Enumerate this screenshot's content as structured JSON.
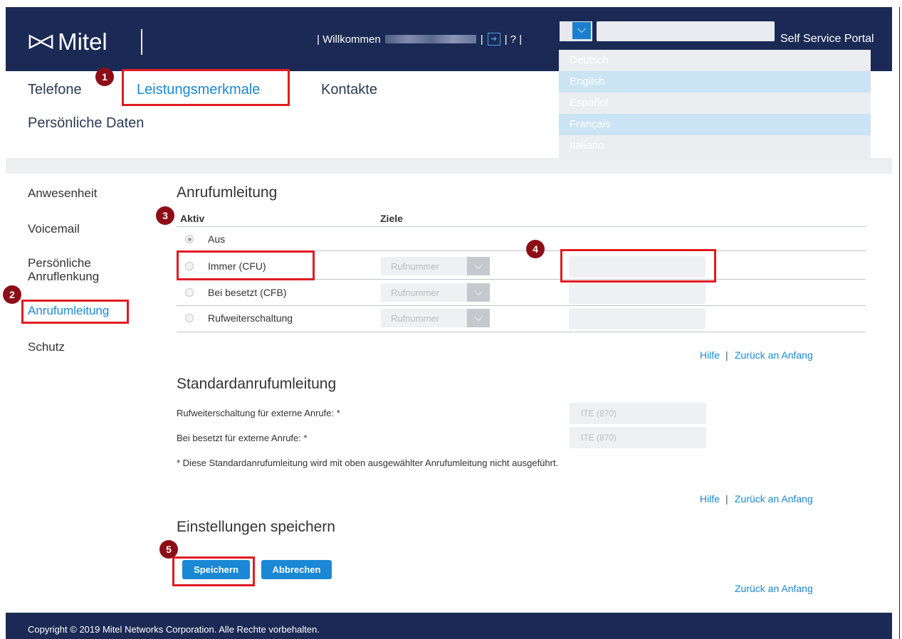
{
  "header": {
    "logo_text": "Mitel",
    "welcome": "| Willkommen",
    "sep1": "|",
    "help": "| ? |",
    "portal_title": "Self Service Portal"
  },
  "language_dropdown": {
    "options": [
      "Deutsch",
      "English",
      "Español",
      "Français",
      "Italiano"
    ]
  },
  "top_nav": {
    "telefone": "Telefone",
    "leistungsmerkmale": "Leistungsmerkmale",
    "kontakte": "Kontakte",
    "persoenliche_daten": "Persönliche Daten"
  },
  "side_nav": {
    "anwesenheit": "Anwesenheit",
    "voicemail": "Voicemail",
    "anruflenkung_1": "Persönliche",
    "anruflenkung_2": "Anruflenkung",
    "anrufumleitung": "Anrufumleitung",
    "schutz": "Schutz"
  },
  "badges": [
    "1",
    "2",
    "3",
    "4",
    "5"
  ],
  "call_forward": {
    "title": "Anrufumleitung",
    "col_active": "Aktiv",
    "col_targets": "Ziele",
    "rows": [
      {
        "label": "Aus",
        "selected": true
      },
      {
        "label": "Immer (CFU)",
        "select": "Rufnummer"
      },
      {
        "label": "Bei besetzt (CFB)",
        "select": "Rufnummer"
      },
      {
        "label": "Rufweiterschaltung",
        "select": "Rufnummer"
      }
    ],
    "help": "Hilfe",
    "pipe": "|",
    "back_to_top": "Zurück an Anfang"
  },
  "default_forward": {
    "title": "Standardanrufumleitung",
    "external_forward_label": "Rufweiterschaltung für externe Anrufe: *",
    "external_forward_value": "ITE (870)",
    "external_busy_label": "Bei besetzt für externe Anrufe: *",
    "external_busy_value": "ITE (870)",
    "note": "* Diese Standardanrufumleitung wird mit oben ausgewählter Anrufumleitung nicht ausgeführt.",
    "help": "Hilfe",
    "pipe": "|",
    "back_to_top": "Zurück an Anfang"
  },
  "save_settings": {
    "title": "Einstellungen speichern",
    "save": "Speichern",
    "cancel": "Abbrechen",
    "back_to_top": "Zurück an Anfang"
  },
  "footer": {
    "copyright": "Copyright © 2019 Mitel Networks Corporation. Alle Rechte vorbehalten."
  },
  "colors": {
    "header_bg": "#1b2a55",
    "accent": "#1a88d4",
    "highlight": "#e01b24",
    "badge": "#8c0d16"
  }
}
